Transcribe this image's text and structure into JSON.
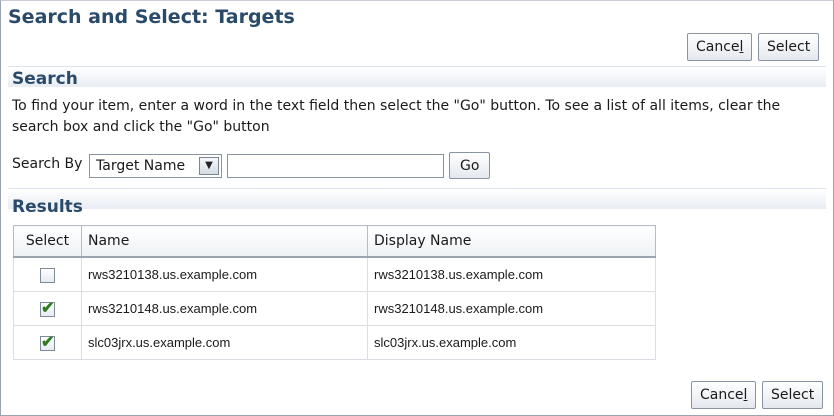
{
  "title": "Search and Select: Targets",
  "buttons": {
    "cancel_label_main": "Cance",
    "cancel_label_u": "l",
    "select_label": "Select",
    "go_label": "Go"
  },
  "search": {
    "heading": "Search",
    "instructions": "To find your item, enter a word in the text field then select the \"Go\" button. To see a list of all items, clear the search box and click the \"Go\" button",
    "search_by_label": "Search By",
    "search_by_value": "Target Name",
    "query_value": ""
  },
  "results": {
    "heading": "Results",
    "columns": [
      "Select",
      "Name",
      "Display Name"
    ],
    "rows": [
      {
        "checked": false,
        "name": "rws3210138.us.example.com",
        "display_name": "rws3210138.us.example.com"
      },
      {
        "checked": true,
        "name": "rws3210148.us.example.com",
        "display_name": "rws3210148.us.example.com"
      },
      {
        "checked": true,
        "name": "slc03jrx.us.example.com",
        "display_name": "slc03jrx.us.example.com"
      }
    ]
  },
  "icons": {
    "dropdown": "chevron-down-icon",
    "checkmark": "checkmark-icon"
  },
  "colors": {
    "heading": "#2a4a6a",
    "check": "#2e7d1e"
  }
}
